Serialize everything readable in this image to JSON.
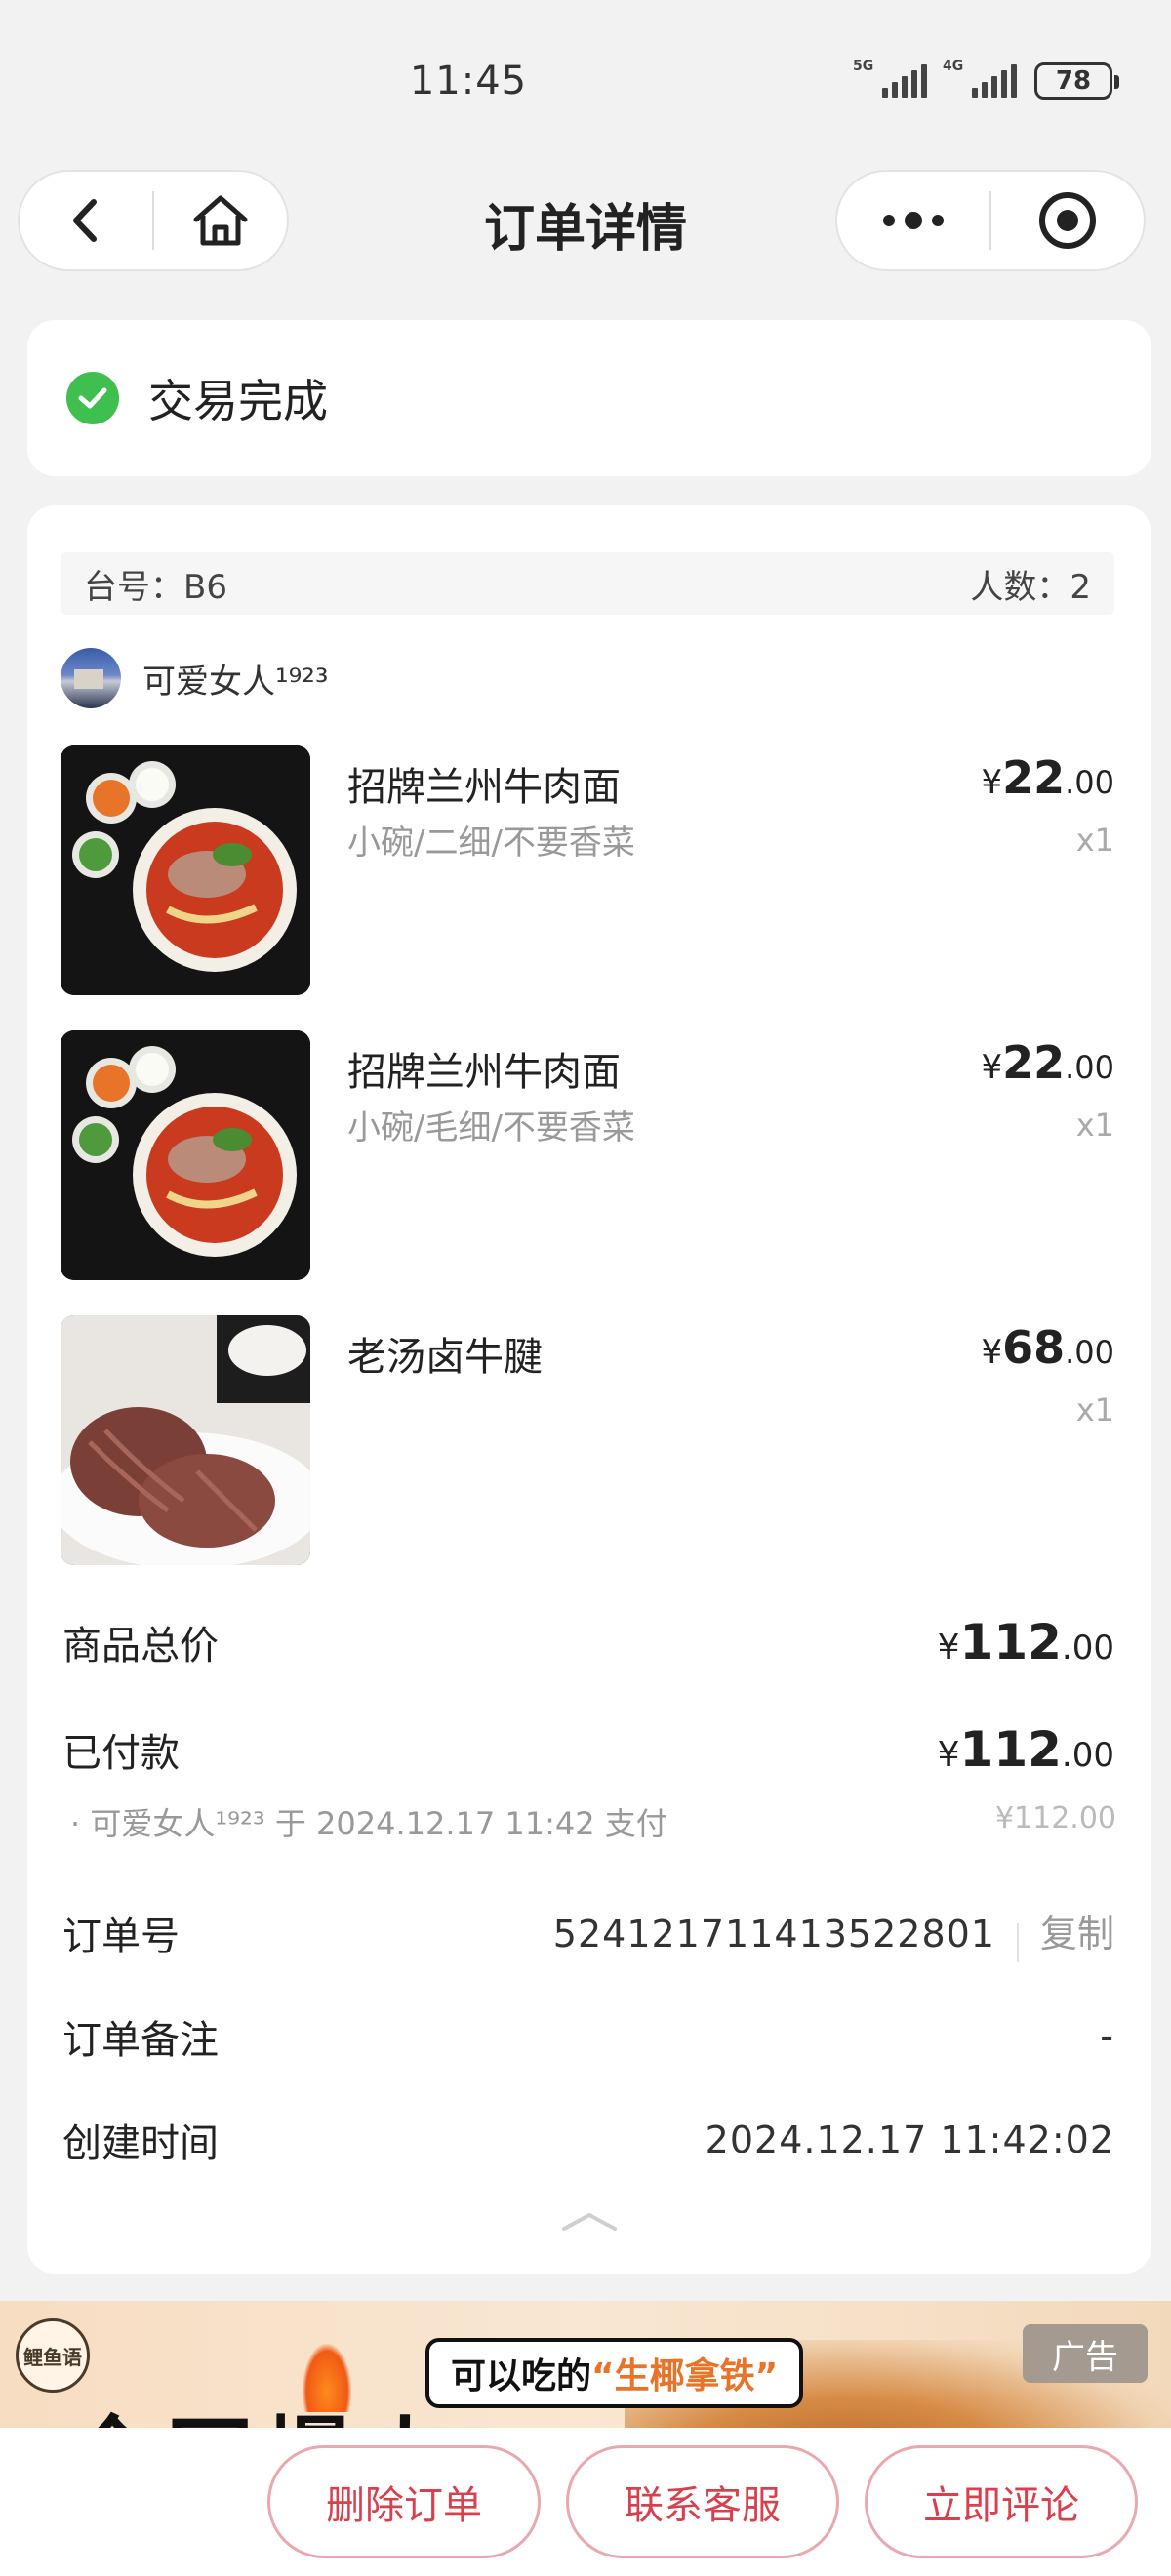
{
  "status_bar": {
    "time": "11:45",
    "signal_1": "5G",
    "signal_2": "4G",
    "battery": "78"
  },
  "nav": {
    "title": "订单详情"
  },
  "order_status": {
    "text": "交易完成"
  },
  "table": {
    "table_label": "台号：B6",
    "people_label": "人数：2"
  },
  "user": {
    "name": "可爱女人¹⁹²³"
  },
  "items": [
    {
      "name": "招牌兰州牛肉面",
      "spec": "小碗/二细/不要香菜",
      "currency": "¥",
      "price_int": "22",
      "price_dec": ".00",
      "qty": "x1"
    },
    {
      "name": "招牌兰州牛肉面",
      "spec": "小碗/毛细/不要香菜",
      "currency": "¥",
      "price_int": "22",
      "price_dec": ".00",
      "qty": "x1"
    },
    {
      "name": "老汤卤牛腱",
      "spec": "",
      "currency": "¥",
      "price_int": "68",
      "price_dec": ".00",
      "qty": "x1"
    }
  ],
  "summary": {
    "total_label": "商品总价",
    "total_currency": "¥",
    "total_int": "112",
    "total_dec": ".00",
    "paid_label": "已付款",
    "paid_currency": "¥",
    "paid_int": "112",
    "paid_dec": ".00",
    "pay_note": "· 可爱女人¹⁹²³ 于 2024.12.17 11:42 支付",
    "pay_note_amount": "¥112.00",
    "order_no_label": "订单号",
    "order_no": "524121711413522801",
    "copy_label": "复制",
    "remark_label": "订单备注",
    "remark": "-",
    "created_label": "创建时间",
    "created": "2024.12.17 11:42:02"
  },
  "ad": {
    "logo_text": "鲤鱼语",
    "bubble_prefix": "可以吃的",
    "bubble_highlight": "“生椰拿铁”",
    "tag": "广告",
    "big_text": "全网爆火"
  },
  "actions": {
    "delete": "删除订单",
    "contact": "联系客服",
    "review": "立即评论"
  },
  "colors": {
    "accent": "#d8404d",
    "success": "#3fbf4f",
    "background": "#f2f2f2"
  }
}
